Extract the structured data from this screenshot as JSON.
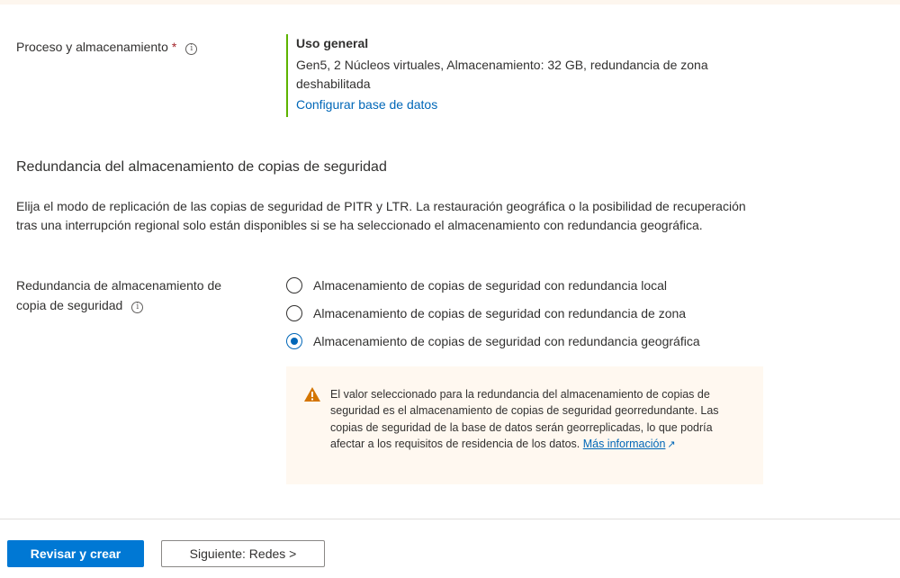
{
  "compute": {
    "label": "Proceso y almacenamiento",
    "required_mark": "*",
    "info_glyph": "i",
    "tier_title": "Uso general",
    "description": "Gen5, 2 Núcleos virtuales, Almacenamiento: 32 GB, redundancia de zona deshabilitada",
    "configure_link": "Configurar base de datos"
  },
  "backup_section": {
    "title": "Redundancia del almacenamiento de copias de seguridad",
    "description": "Elija el modo de replicación de las copias de seguridad de PITR y LTR. La restauración geográfica o la posibilidad de recuperación tras una interrupción regional solo están disponibles si se ha seleccionado el almacenamiento con redundancia geográfica.",
    "field_label_line1": "Redundancia de almacenamiento de",
    "field_label_line2": "copia de seguridad",
    "options": [
      {
        "label": "Almacenamiento de copias de seguridad con redundancia local",
        "selected": false
      },
      {
        "label": "Almacenamiento de copias de seguridad con redundancia de zona",
        "selected": false
      },
      {
        "label": "Almacenamiento de copias de seguridad con redundancia geográfica",
        "selected": true
      }
    ]
  },
  "warning": {
    "icon": "warning-triangle-icon",
    "text": "El valor seleccionado para la redundancia del almacenamiento de copias de seguridad es el almacenamiento de copias de seguridad georredundante. Las copias de seguridad de la base de datos serán georreplicadas, lo que podría afectar a los requisitos de residencia de los datos. ",
    "link": "Más información",
    "link_icon": "external-link-icon"
  },
  "footer": {
    "review_button": "Revisar y crear",
    "next_button": "Siguiente: Redes >"
  },
  "colors": {
    "accent": "#0078d4",
    "link": "#0067b8",
    "compute_bar": "#5db300",
    "warning_bg": "#fff8f0",
    "warning_icon": "#d47500",
    "required": "#a4262c"
  }
}
